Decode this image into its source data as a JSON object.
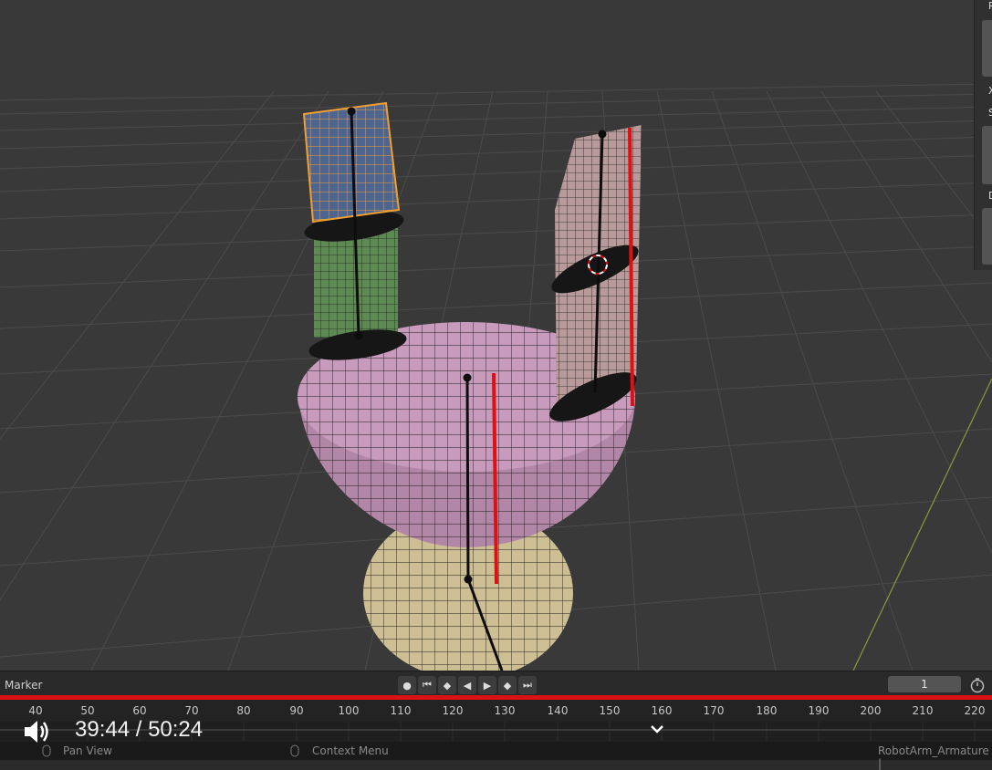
{
  "timeline": {
    "marker_label": "Marker",
    "current_frame": "1",
    "ruler_ticks": [
      "40",
      "50",
      "60",
      "70",
      "80",
      "90",
      "100",
      "110",
      "120",
      "130",
      "140",
      "150",
      "160",
      "170",
      "180",
      "190",
      "200",
      "210",
      "220"
    ],
    "transport_buttons": [
      "record-dot",
      "jump-start",
      "prev-keyframe",
      "play-reverse",
      "play",
      "next-keyframe",
      "jump-end"
    ]
  },
  "video": {
    "time": "39:44 / 50:24",
    "progress": 0.789
  },
  "statusbar": {
    "pan_view": "Pan View",
    "context_menu": "Context Menu",
    "object_name": "RobotArm_Armature |"
  },
  "side_panel": {
    "labels": [
      "R",
      "X",
      "S",
      "D"
    ]
  },
  "colors": {
    "selected_outline": "#f0a030",
    "bone_red": "#e01010",
    "progress_red": "#d11111"
  }
}
